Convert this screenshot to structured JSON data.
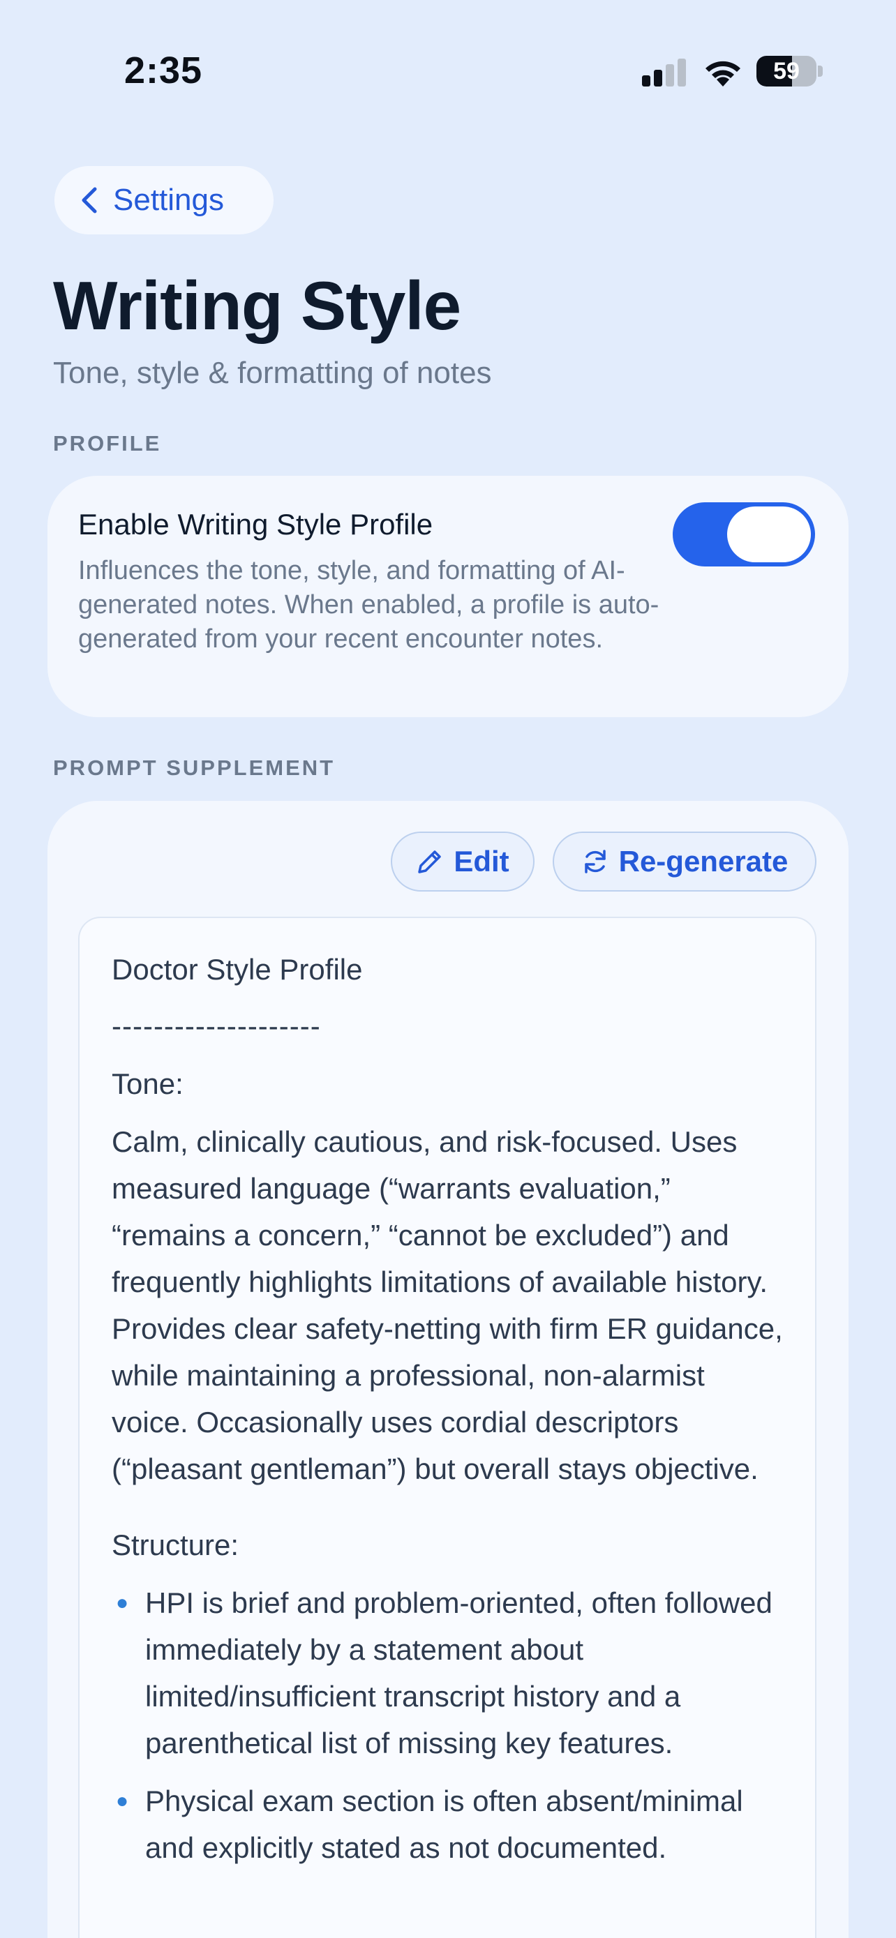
{
  "status_bar": {
    "time": "2:35",
    "battery_level": "59"
  },
  "nav": {
    "back_label": "Settings"
  },
  "header": {
    "title": "Writing Style",
    "subtitle": "Tone, style & formatting of notes"
  },
  "profile_section": {
    "label": "PROFILE",
    "toggle_title": "Enable Writing Style Profile",
    "toggle_description": "Influences the tone, style, and formatting of AI-generated notes. When enabled, a profile is auto-generated from your recent encounter notes.",
    "enabled": true
  },
  "supplement_section": {
    "label": "PROMPT SUPPLEMENT",
    "edit_label": "Edit",
    "regenerate_label": "Re-generate",
    "doc": {
      "title": "Doctor Style Profile",
      "divider": "--------------------",
      "tone_heading": "Tone:",
      "tone_text": "Calm, clinically cautious, and risk-focused. Uses measured language (“warrants evaluation,” “remains a concern,” “cannot be excluded”) and frequently highlights limitations of available history. Provides clear safety-netting with firm ER guidance, while maintaining a professional, non-alarmist voice. Occasionally uses cordial descriptors (“pleasant gentleman”) but overall stays objective.",
      "structure_heading": "Structure:",
      "structure_items": [
        "HPI is brief and problem-oriented, often followed immediately by a statement about limited/insufficient transcript history and a parenthetical list of missing key features.",
        "Physical exam section is often absent/minimal and explicitly stated as not documented."
      ]
    }
  },
  "colors": {
    "background": "#e2ecfc",
    "card": "#f3f7fe",
    "accent": "#2563eb",
    "link": "#2459d8",
    "secondary_text": "#6a788c"
  }
}
